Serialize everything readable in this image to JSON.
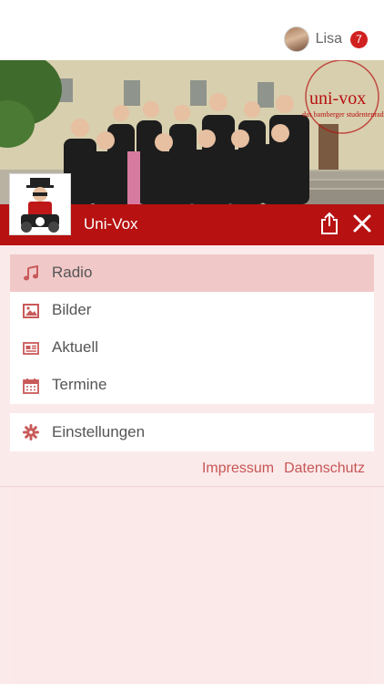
{
  "user": {
    "name": "Lisa",
    "notifications": "7"
  },
  "header": {
    "title": "Uni-Vox",
    "banner_text": "uni-vox",
    "banner_subtext": "das bamberger studentenradio"
  },
  "menu": {
    "items": [
      {
        "label": "Radio",
        "icon": "music-note-icon"
      },
      {
        "label": "Bilder",
        "icon": "image-icon"
      },
      {
        "label": "Aktuell",
        "icon": "newspaper-icon"
      },
      {
        "label": "Termine",
        "icon": "calendar-icon"
      }
    ],
    "settings_label": "Einstellungen"
  },
  "footer": {
    "impressum": "Impressum",
    "datenschutz": "Datenschutz"
  },
  "colors": {
    "brand": "#b71111",
    "active_item": "#f1c8c8",
    "icon": "#c95a5a",
    "background": "#fbeaea"
  }
}
